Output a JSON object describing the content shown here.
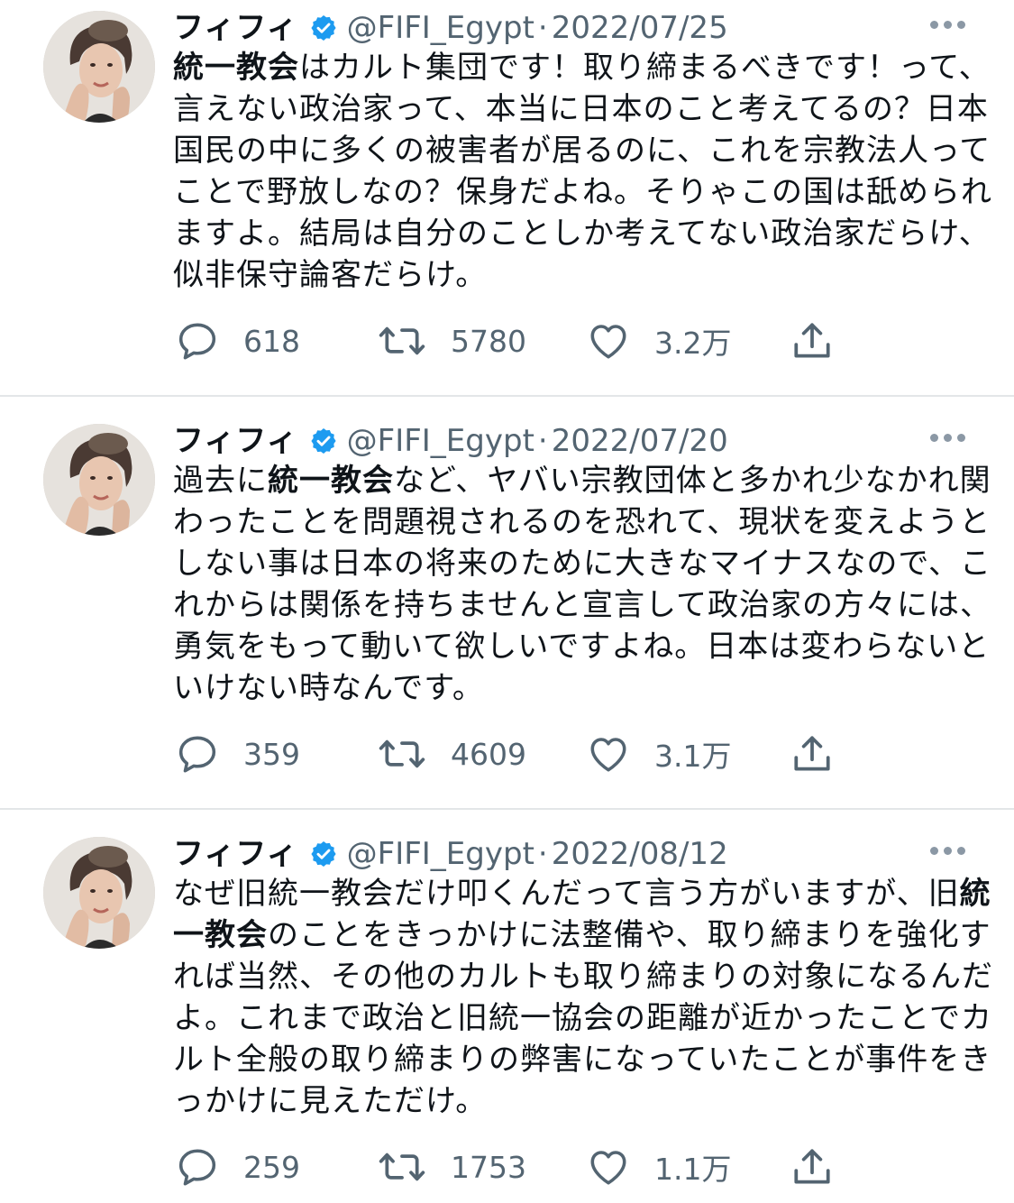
{
  "tweets": [
    {
      "user": {
        "name": "フィフィ",
        "handle": "@FIFI_Egypt"
      },
      "date": "2022/07/25",
      "lines": [
        [
          {
            "t": "統一教会",
            "b": true
          },
          {
            "t": "はカルト集団です！取り締まるべきです！って、",
            "b": false
          }
        ],
        [
          {
            "t": "言えない政治家って、本当に日本のこと考えてるの？日本",
            "b": false
          }
        ],
        [
          {
            "t": "国民の中に多くの被害者が居るのに、これを宗教法人って",
            "b": false
          }
        ],
        [
          {
            "t": "ことで野放しなの？保身だよね。そりゃこの国は舐められ",
            "b": false
          }
        ],
        [
          {
            "t": "ますよ。結局は自分のことしか考えてない政治家だらけ、",
            "b": false
          }
        ],
        [
          {
            "t": "似非保守論客だらけ。",
            "b": false
          }
        ]
      ],
      "stats": {
        "replies": "618",
        "retweets": "5780",
        "likes": "3.2万"
      }
    },
    {
      "user": {
        "name": "フィフィ",
        "handle": "@FIFI_Egypt"
      },
      "date": "2022/07/20",
      "lines": [
        [
          {
            "t": "過去に",
            "b": false
          },
          {
            "t": "統一教会",
            "b": true
          },
          {
            "t": "など、ヤバい宗教団体と多かれ少なかれ関",
            "b": false
          }
        ],
        [
          {
            "t": "わったことを問題視されるのを恐れて、現状を変えようと",
            "b": false
          }
        ],
        [
          {
            "t": "しない事は日本の将来のために大きなマイナスなので、こ",
            "b": false
          }
        ],
        [
          {
            "t": "れからは関係を持ちませんと宣言して政治家の方々には、",
            "b": false
          }
        ],
        [
          {
            "t": "勇気をもって動いて欲しいですよね。日本は変わらないと",
            "b": false
          }
        ],
        [
          {
            "t": "いけない時なんです。",
            "b": false
          }
        ]
      ],
      "stats": {
        "replies": "359",
        "retweets": "4609",
        "likes": "3.1万"
      }
    },
    {
      "user": {
        "name": "フィフィ",
        "handle": "@FIFI_Egypt"
      },
      "date": "2022/08/12",
      "lines": [
        [
          {
            "t": "なぜ旧統一教会だけ叩くんだって言う方がいますが、旧",
            "b": false
          },
          {
            "t": "統",
            "b": true
          }
        ],
        [
          {
            "t": "一教会",
            "b": true
          },
          {
            "t": "のことをきっかけに法整備や、取り締まりを強化す",
            "b": false
          }
        ],
        [
          {
            "t": "れば当然、その他のカルトも取り締まりの対象になるんだ",
            "b": false
          }
        ],
        [
          {
            "t": "よ。これまで政治と旧統一協会の距離が近かったことでカ",
            "b": false
          }
        ],
        [
          {
            "t": "ルト全般の取り締まりの弊害になっていたことが事件をき",
            "b": false
          }
        ],
        [
          {
            "t": "っかけに見えただけ。",
            "b": false
          }
        ]
      ],
      "stats": {
        "replies": "259",
        "retweets": "1753",
        "likes": "1.1万"
      }
    }
  ],
  "icons": {
    "verified": "verified-badge-icon",
    "more": "more-options-icon",
    "reply": "reply-icon",
    "retweet": "retweet-icon",
    "like": "like-icon",
    "share": "share-icon"
  },
  "colors": {
    "text": "#0f1419",
    "secondary": "#536471",
    "verified": "#1d9bf0",
    "divider": "#e3e6e8"
  }
}
